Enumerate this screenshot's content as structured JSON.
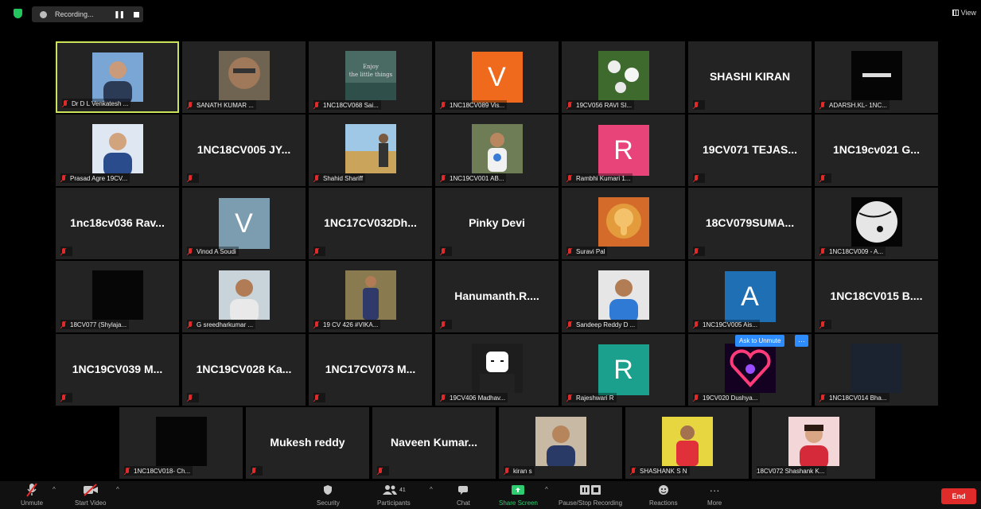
{
  "top_bar": {
    "recording_label": "Recording...",
    "view_label": "View"
  },
  "participants": [
    {
      "label": "Dr D L Venkatesh ...",
      "kind": "photo",
      "photo": "man-suit-portrait",
      "active": true
    },
    {
      "label": "SANATH KUMAR ...",
      "kind": "photo",
      "photo": "man-face-portrait"
    },
    {
      "label": "1NC18CV068 Sai...",
      "kind": "photo",
      "photo": "quote-poster"
    },
    {
      "label": "1NC18CV089 Vis...",
      "kind": "letter",
      "letter": "V",
      "color": "#f06a1d"
    },
    {
      "label": "19CV056 RAVI SI...",
      "kind": "photo",
      "photo": "white-flowers"
    },
    {
      "big": "SHASHI KIRAN",
      "kind": "name"
    },
    {
      "label": "ADARSH.KL- 1NC...",
      "kind": "photo",
      "photo": "champion-logo"
    },
    {
      "label": "Prasad Agre 19CV...",
      "kind": "photo",
      "photo": "man-blue-suit"
    },
    {
      "big": "1NC18CV005 JY...",
      "kind": "name"
    },
    {
      "label": "Shahid Shariff",
      "kind": "photo",
      "photo": "man-field"
    },
    {
      "label": "1NC19CV001 AB...",
      "kind": "photo",
      "photo": "man-outdoors"
    },
    {
      "label": "Rambhi Kumari 1...",
      "kind": "letter",
      "letter": "R",
      "color": "#e8447a"
    },
    {
      "big": "19CV071 TEJAS...",
      "kind": "name"
    },
    {
      "big": "1NC19cv021 G...",
      "kind": "name"
    },
    {
      "big": "1nc18cv036 Rav...",
      "kind": "name"
    },
    {
      "label": "Vinod A Soudi",
      "kind": "letter",
      "letter": "V",
      "color": "#7c9cb0"
    },
    {
      "big": "1NC17CV032Dh...",
      "kind": "name"
    },
    {
      "big": "Pinky Devi",
      "kind": "name"
    },
    {
      "label": "Suravi Pal",
      "kind": "photo",
      "photo": "ganesha-art"
    },
    {
      "big": "18CV079SUMA...",
      "kind": "name"
    },
    {
      "label": "1NC18CV009 - A...",
      "kind": "photo",
      "photo": "moon-silhouette"
    },
    {
      "label": "18CV077 (Shylaja...",
      "kind": "photo",
      "photo": "black-square"
    },
    {
      "label": "G sreedharkumar ...",
      "kind": "photo",
      "photo": "man-selfie"
    },
    {
      "label": "19 CV 426 #VIKA...",
      "kind": "photo",
      "photo": "man-standing"
    },
    {
      "big": "Hanumanth.R....",
      "kind": "name"
    },
    {
      "label": "Sandeep Reddy D ...",
      "kind": "photo",
      "photo": "man-white-shirt"
    },
    {
      "label": "1NC19CV005 Ais...",
      "kind": "letter",
      "letter": "A",
      "color": "#1f6fb5"
    },
    {
      "big": "1NC18CV015 B....",
      "kind": "name"
    },
    {
      "big": "1NC19CV039 M...",
      "kind": "name"
    },
    {
      "big": "1NC19CV028 Ka...",
      "kind": "name"
    },
    {
      "big": "1NC17CV073 M...",
      "kind": "name"
    },
    {
      "label": "19CV406 Madhav...",
      "kind": "photo",
      "photo": "marshmello"
    },
    {
      "label": "Rajeshwari R",
      "kind": "letter",
      "letter": "R",
      "color": "#1aa08d"
    },
    {
      "label": "19CV020 Dushya...",
      "kind": "photo",
      "photo": "neon-heart"
    },
    {
      "label": "1NC18CV014 Bha...",
      "kind": "photo",
      "photo": "dark-navy"
    },
    {
      "label": "1NC18CV018- Ch...",
      "kind": "photo",
      "photo": "black-square"
    },
    {
      "big": "Mukesh reddy",
      "kind": "name"
    },
    {
      "big": "Naveen Kumar...",
      "kind": "name"
    },
    {
      "label": "kiran s",
      "kind": "photo",
      "photo": "man-suit-indoors"
    },
    {
      "label": "SHASHANK S N",
      "kind": "photo",
      "photo": "man-yellow"
    },
    {
      "label": "18CV072 Shashank K...",
      "kind": "photo",
      "photo": "man-red-shirt",
      "unmuted": true
    }
  ],
  "ask_to_unmute": {
    "label": "Ask to Unmute",
    "more": "···"
  },
  "toolbar": {
    "unmute": "Unmute",
    "start_video": "Start Video",
    "security": "Security",
    "participants_count": "41",
    "participants": "Participants",
    "chat": "Chat",
    "share_screen": "Share Screen",
    "pause_stop": "Pause/Stop Recording",
    "reactions": "Reactions",
    "more_dots": "···",
    "more": "More",
    "end": "End"
  }
}
